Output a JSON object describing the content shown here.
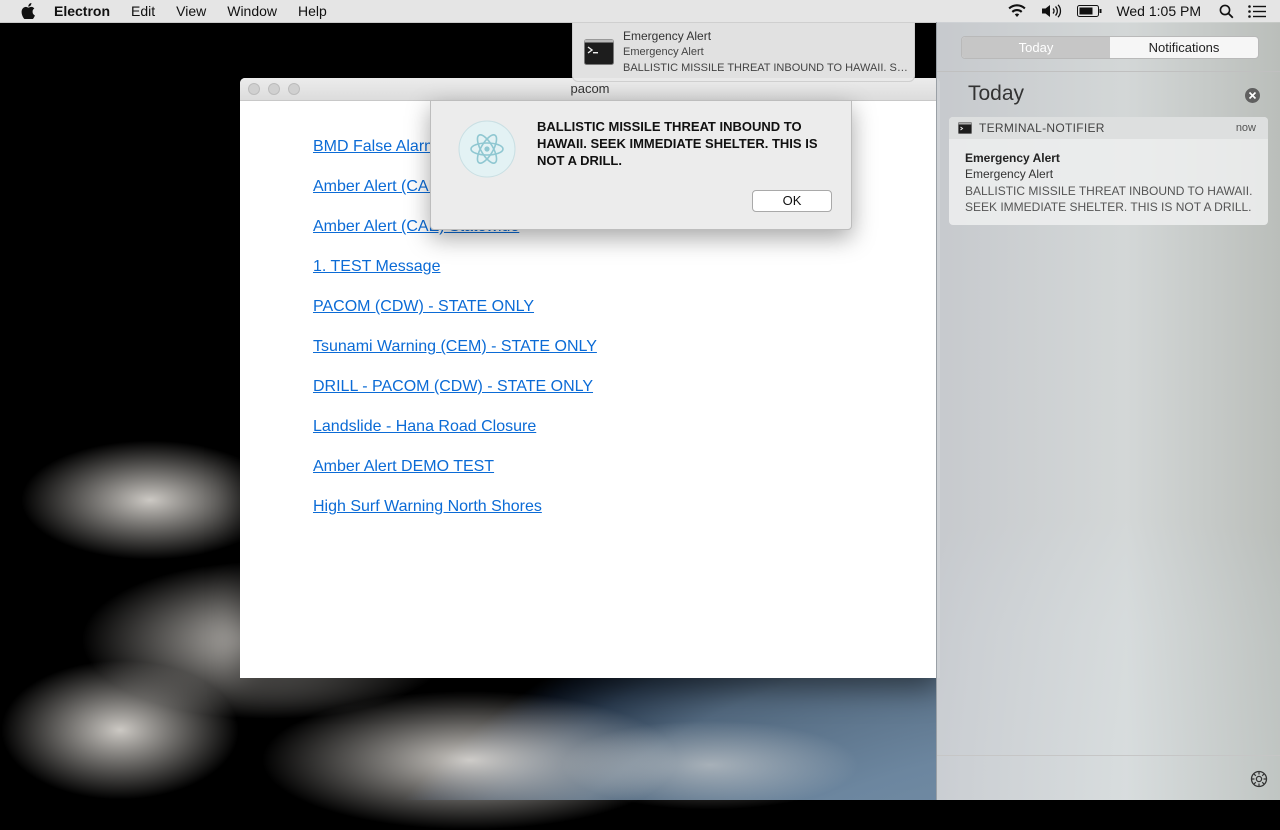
{
  "menubar": {
    "app_name": "Electron",
    "items": [
      "Edit",
      "View",
      "Window",
      "Help"
    ],
    "clock": "Wed 1:05 PM",
    "icons": [
      "apple-icon",
      "wifi-icon",
      "volume-icon",
      "battery-icon",
      "search-icon",
      "notification-center-icon"
    ]
  },
  "window": {
    "title": "pacom",
    "links": [
      "BMD False Alarm",
      "Amber Alert (CAE) - Kauai County Only",
      "Amber Alert (CAE) Statewide",
      "1. TEST Message",
      "PACOM (CDW) - STATE ONLY",
      "Tsunami Warning (CEM) - STATE ONLY",
      "DRILL - PACOM (CDW) - STATE ONLY",
      "Landslide - Hana Road Closure",
      "Amber Alert DEMO TEST",
      "High Surf Warning North Shores"
    ]
  },
  "alert": {
    "message": "BALLISTIC MISSILE THREAT INBOUND TO HAWAII. SEEK IMMEDIATE SHELTER. THIS IS NOT A DRILL.",
    "ok_label": "OK"
  },
  "banner": {
    "title": "Emergency Alert",
    "subtitle": "Emergency Alert",
    "body": "BALLISTIC MISSILE THREAT INBOUND TO HAWAII. SEEK IMMEDIATE SHELTER. THIS IS NOT A DRILL."
  },
  "notification_center": {
    "tabs": [
      "Today",
      "Notifications"
    ],
    "active_tab": "Today",
    "heading": "Today",
    "card": {
      "app": "TERMINAL-NOTIFIER",
      "time": "now",
      "title": "Emergency Alert",
      "subtitle": "Emergency Alert",
      "body": "BALLISTIC MISSILE THREAT INBOUND TO HAWAII. SEEK IMMEDIATE SHELTER. THIS IS NOT A DRILL."
    }
  }
}
